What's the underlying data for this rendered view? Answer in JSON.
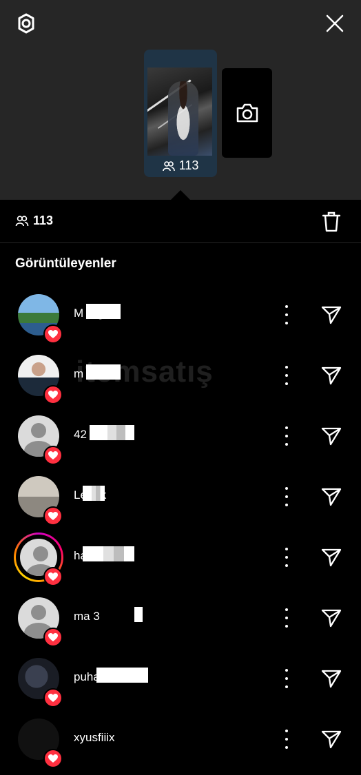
{
  "story": {
    "viewer_count": "113"
  },
  "viewers_bar": {
    "count": "113"
  },
  "section_title": "Görüntüleyenler",
  "watermark": "itemsatış",
  "viewers": [
    {
      "name": "M          urgut",
      "avatar": "photo1",
      "ring": false
    },
    {
      "name": "m           silncr",
      "avatar": "photo2",
      "ring": false
    },
    {
      "name": "42           5",
      "avatar": "default",
      "ring": false
    },
    {
      "name": "Le          rük",
      "avatar": "photo3",
      "ring": false
    },
    {
      "name": "ha              1",
      "avatar": "default",
      "ring": true
    },
    {
      "name": "ma           3",
      "avatar": "default",
      "ring": false
    },
    {
      "name": "puha          a",
      "avatar": "photo4",
      "ring": false
    },
    {
      "name": "xyusfiiix",
      "avatar": "photo5",
      "ring": false
    }
  ],
  "colors": {
    "top_bg": "#262626",
    "selected_story": "#1f3446",
    "like_badge": "#ff3040"
  }
}
